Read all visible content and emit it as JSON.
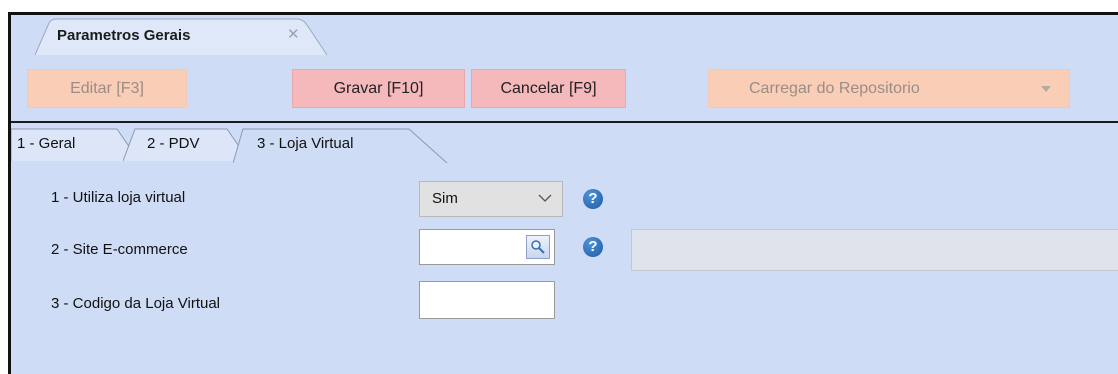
{
  "window_tab": {
    "title": "Parametros Gerais",
    "close_glyph": "✕"
  },
  "toolbar": {
    "editar_label": "Editar [F3]",
    "gravar_label": "Gravar [F10]",
    "cancelar_label": "Cancelar [F9]",
    "carregar_label": "Carregar do Repositorio"
  },
  "tabs": [
    {
      "label": "1 - Geral"
    },
    {
      "label": "2 - PDV"
    },
    {
      "label": "3 - Loja Virtual"
    }
  ],
  "form": {
    "utiliza_loja_virtual": {
      "label": "1 - Utiliza loja virtual",
      "value": "Sim"
    },
    "site_ecommerce": {
      "label": "2 - Site E-commerce",
      "value": ""
    },
    "codigo_loja_virtual": {
      "label": "3 - Codigo da Loja Virtual",
      "value": ""
    }
  },
  "help_glyph": "?",
  "colors": {
    "background": "#cfdcf5",
    "primary_button": "#f5b9bc",
    "disabled_button": "#f9cdb6",
    "help_icon": "#1d5aa6"
  },
  "icons": [
    "close-icon",
    "chevron-down-icon",
    "dropdown-arrow-icon",
    "lookup-search-icon",
    "help-icon"
  ]
}
